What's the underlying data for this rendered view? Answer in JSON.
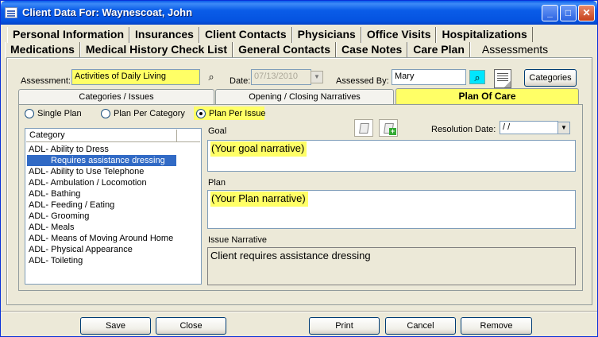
{
  "window": {
    "title": "Client Data For: Waynescoat, John",
    "min_glyph": "_",
    "max_glyph": "□",
    "close_glyph": "✕"
  },
  "top_tabs_row1": [
    "Personal Information",
    "Insurances",
    "Client Contacts",
    "Physicians",
    "Office Visits",
    "Hospitalizations"
  ],
  "top_tabs_row2": [
    "Medications",
    "Medical History Check List",
    "General Contacts",
    "Case Notes",
    "Care Plan",
    "Assessments"
  ],
  "assessment": {
    "assessment_label": "Assessment:",
    "assessment_value": "Activities of Daily Living",
    "date_label": "Date:",
    "date_value": "07/13/2010",
    "assessed_by_label": "Assessed By:",
    "assessed_by_value": "Mary",
    "categories_button": "Categories"
  },
  "sub_tabs": [
    "Categories / Issues",
    "Opening / Closing Narratives",
    "Plan Of Care"
  ],
  "plan_mode": {
    "options": [
      "Single Plan",
      "Plan Per Category",
      "Plan Per Issue"
    ],
    "selected": "Plan Per Issue"
  },
  "category_list": {
    "header": "Category",
    "items": [
      "ADL- Ability to Dress",
      "Requires assistance dressing",
      "ADL- Ability to Use Telephone",
      "ADL- Ambulation / Locomotion",
      "ADL- Bathing",
      "ADL- Feeding / Eating",
      "ADL- Grooming",
      "ADL- Meals",
      "ADL- Means of Moving Around Home",
      "ADL- Physical Appearance",
      "ADL- Toileting"
    ],
    "selected": "Requires assistance dressing"
  },
  "plan_of_care": {
    "goal_label": "Goal",
    "goal_text": "(Your goal narrative)",
    "resolution_date_label": "Resolution Date:",
    "resolution_date_value": " / /",
    "plan_label": "Plan",
    "plan_text": "(Your Plan narrative)",
    "issue_narrative_label": "Issue Narrative",
    "issue_narrative_text": "Client requires assistance dressing"
  },
  "footer_buttons": [
    "Save",
    "Close",
    "Print",
    "Cancel",
    "Remove"
  ],
  "icons": {
    "binoculars": "binoculars-icon",
    "dropdown": "▼",
    "notepad": "notepad-icon"
  },
  "colors": {
    "highlight": "#ffff66",
    "selection": "#316ac5",
    "titlebar": "#0a5ce8"
  }
}
